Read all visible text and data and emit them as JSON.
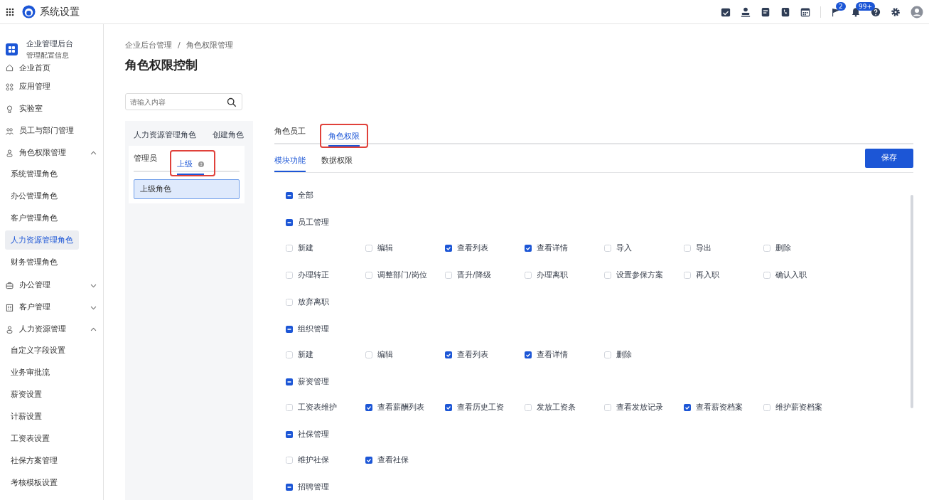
{
  "app_bar": {
    "title": "系统设置",
    "badges": [
      "2",
      "99+"
    ]
  },
  "sidebar": {
    "org": {
      "name": "企业管理后台",
      "subtitle": "管理配置信息"
    },
    "items": [
      {
        "label": "企业首页",
        "kind": "link"
      },
      {
        "label": "应用管理",
        "kind": "link"
      },
      {
        "label": "实验室",
        "kind": "link"
      },
      {
        "label": "员工与部门管理",
        "kind": "link"
      },
      {
        "label": "角色权限管理",
        "kind": "group",
        "expanded": true,
        "children": [
          {
            "label": "系统管理角色",
            "selected": false
          },
          {
            "label": "办公管理角色",
            "selected": false
          },
          {
            "label": "客户管理角色",
            "selected": false
          },
          {
            "label": "人力资源管理角色",
            "selected": true
          },
          {
            "label": "财务管理角色",
            "selected": false
          }
        ]
      },
      {
        "label": "办公管理",
        "kind": "group",
        "expanded": false
      },
      {
        "label": "客户管理",
        "kind": "group",
        "expanded": false
      },
      {
        "label": "人力资源管理",
        "kind": "group",
        "expanded": true,
        "children": [
          {
            "label": "自定义字段设置",
            "selected": false
          },
          {
            "label": "业务审批流",
            "selected": false
          },
          {
            "label": "薪资设置",
            "selected": false
          },
          {
            "label": "计薪设置",
            "selected": false
          },
          {
            "label": "工资表设置",
            "selected": false
          },
          {
            "label": "社保方案管理",
            "selected": false
          },
          {
            "label": "考核模板设置",
            "selected": false
          }
        ]
      }
    ]
  },
  "breadcrumb": [
    "企业后台管理",
    "角色权限管理"
  ],
  "breadcrumb_separator": "/",
  "page_title": "角色权限控制",
  "search": {
    "placeholder": "请输入内容"
  },
  "role_panel": {
    "title": "人力资源管理角色",
    "create_link": "创建角色",
    "tabs": [
      {
        "label": "管理员",
        "selected": false,
        "highlighted": false
      },
      {
        "label": "上级",
        "selected": true,
        "highlighted": true
      }
    ],
    "roles": [
      {
        "label": "上级角色",
        "selected": true
      }
    ]
  },
  "main_tabs": [
    {
      "label": "角色员工",
      "selected": false,
      "highlighted": false
    },
    {
      "label": "角色权限",
      "selected": true,
      "highlighted": true
    }
  ],
  "sub_tabs": [
    {
      "label": "模块功能",
      "selected": true
    },
    {
      "label": "数据权限",
      "selected": false
    }
  ],
  "save_button": "保存",
  "permissions": [
    {
      "label": "全部",
      "partial": true
    },
    {
      "label": "员工管理",
      "partial": true,
      "items": [
        {
          "label": "新建",
          "checked": false
        },
        {
          "label": "编辑",
          "checked": false
        },
        {
          "label": "查看列表",
          "checked": true
        },
        {
          "label": "查看详情",
          "checked": true
        },
        {
          "label": "导入",
          "checked": false
        },
        {
          "label": "导出",
          "checked": false
        },
        {
          "label": "删除",
          "checked": false
        },
        {
          "label": "办理转正",
          "checked": false
        },
        {
          "label": "调整部门/岗位",
          "checked": false
        },
        {
          "label": "晋升/降级",
          "checked": false
        },
        {
          "label": "办理离职",
          "checked": false
        },
        {
          "label": "设置参保方案",
          "checked": false
        },
        {
          "label": "再入职",
          "checked": false
        },
        {
          "label": "确认入职",
          "checked": false
        },
        {
          "label": "放弃离职",
          "checked": false
        }
      ]
    },
    {
      "label": "组织管理",
      "partial": true,
      "items": [
        {
          "label": "新建",
          "checked": false
        },
        {
          "label": "编辑",
          "checked": false
        },
        {
          "label": "查看列表",
          "checked": true
        },
        {
          "label": "查看详情",
          "checked": true
        },
        {
          "label": "删除",
          "checked": false
        }
      ]
    },
    {
      "label": "薪资管理",
      "partial": true,
      "items": [
        {
          "label": "工资表维护",
          "checked": false
        },
        {
          "label": "查看薪酬列表",
          "checked": true
        },
        {
          "label": "查看历史工资",
          "checked": true
        },
        {
          "label": "发放工资条",
          "checked": false
        },
        {
          "label": "查看发放记录",
          "checked": false
        },
        {
          "label": "查看薪资档案",
          "checked": true
        },
        {
          "label": "维护薪资档案",
          "checked": false
        }
      ]
    },
    {
      "label": "社保管理",
      "partial": true,
      "items": [
        {
          "label": "维护社保",
          "checked": false
        },
        {
          "label": "查看社保",
          "checked": true
        }
      ]
    },
    {
      "label": "招聘管理",
      "partial": true
    }
  ]
}
